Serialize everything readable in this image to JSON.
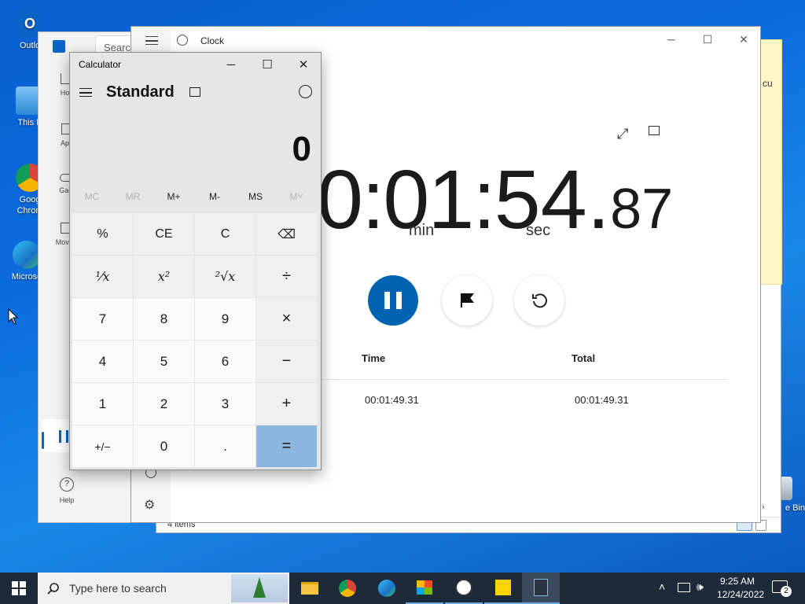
{
  "desktop": {
    "icons": [
      {
        "label": "Outlo",
        "name": "outlook"
      },
      {
        "label": "This P",
        "name": "this-pc"
      },
      {
        "label": "Goog",
        "label2": "Chrom",
        "name": "chrome"
      },
      {
        "label": "Microso",
        "name": "edge"
      },
      {
        "label": "e Bin",
        "name": "recycle-bin"
      }
    ]
  },
  "store": {
    "search_placeholder": "Searc",
    "nav": [
      "Hon",
      "App",
      "Gam",
      "Movies",
      "Help"
    ]
  },
  "explorer": {
    "status": "4 items",
    "partial_text": "cu"
  },
  "clock": {
    "title": "Clock",
    "timer": {
      "prefix": "0:01:",
      "seconds": "54",
      "dot": ".",
      "hundredths": "87"
    },
    "units": {
      "min": "min",
      "sec": "sec"
    },
    "laps": {
      "headers": {
        "time": "Time",
        "total": "Total"
      },
      "rows": [
        {
          "time": "00:01:49.31",
          "total": "00:01:49.31"
        }
      ]
    }
  },
  "calculator": {
    "title": "Calculator",
    "mode": "Standard",
    "display": "0",
    "memory": [
      {
        "label": "MC",
        "enabled": false
      },
      {
        "label": "MR",
        "enabled": false
      },
      {
        "label": "M+",
        "enabled": true
      },
      {
        "label": "M-",
        "enabled": true
      },
      {
        "label": "MS",
        "enabled": true
      },
      {
        "label": "M˅",
        "enabled": false
      }
    ],
    "keys": {
      "percent": "%",
      "ce": "CE",
      "c": "C",
      "backspace": "⌫",
      "reciprocal": "¹⁄x",
      "square": "x²",
      "sqrt": "²√x",
      "divide": "÷",
      "k7": "7",
      "k8": "8",
      "k9": "9",
      "multiply": "×",
      "k4": "4",
      "k5": "5",
      "k6": "6",
      "minus": "−",
      "k1": "1",
      "k2": "2",
      "k3": "3",
      "plus": "+",
      "negate": "+/−",
      "k0": "0",
      "decimal": ".",
      "equals": "="
    }
  },
  "taskbar": {
    "search_placeholder": "Type here to search",
    "time": "9:25 AM",
    "date": "12/24/2022",
    "notification_count": "2",
    "colors": {
      "bg": "#1c2a3a",
      "accent": "#0063b1"
    }
  }
}
